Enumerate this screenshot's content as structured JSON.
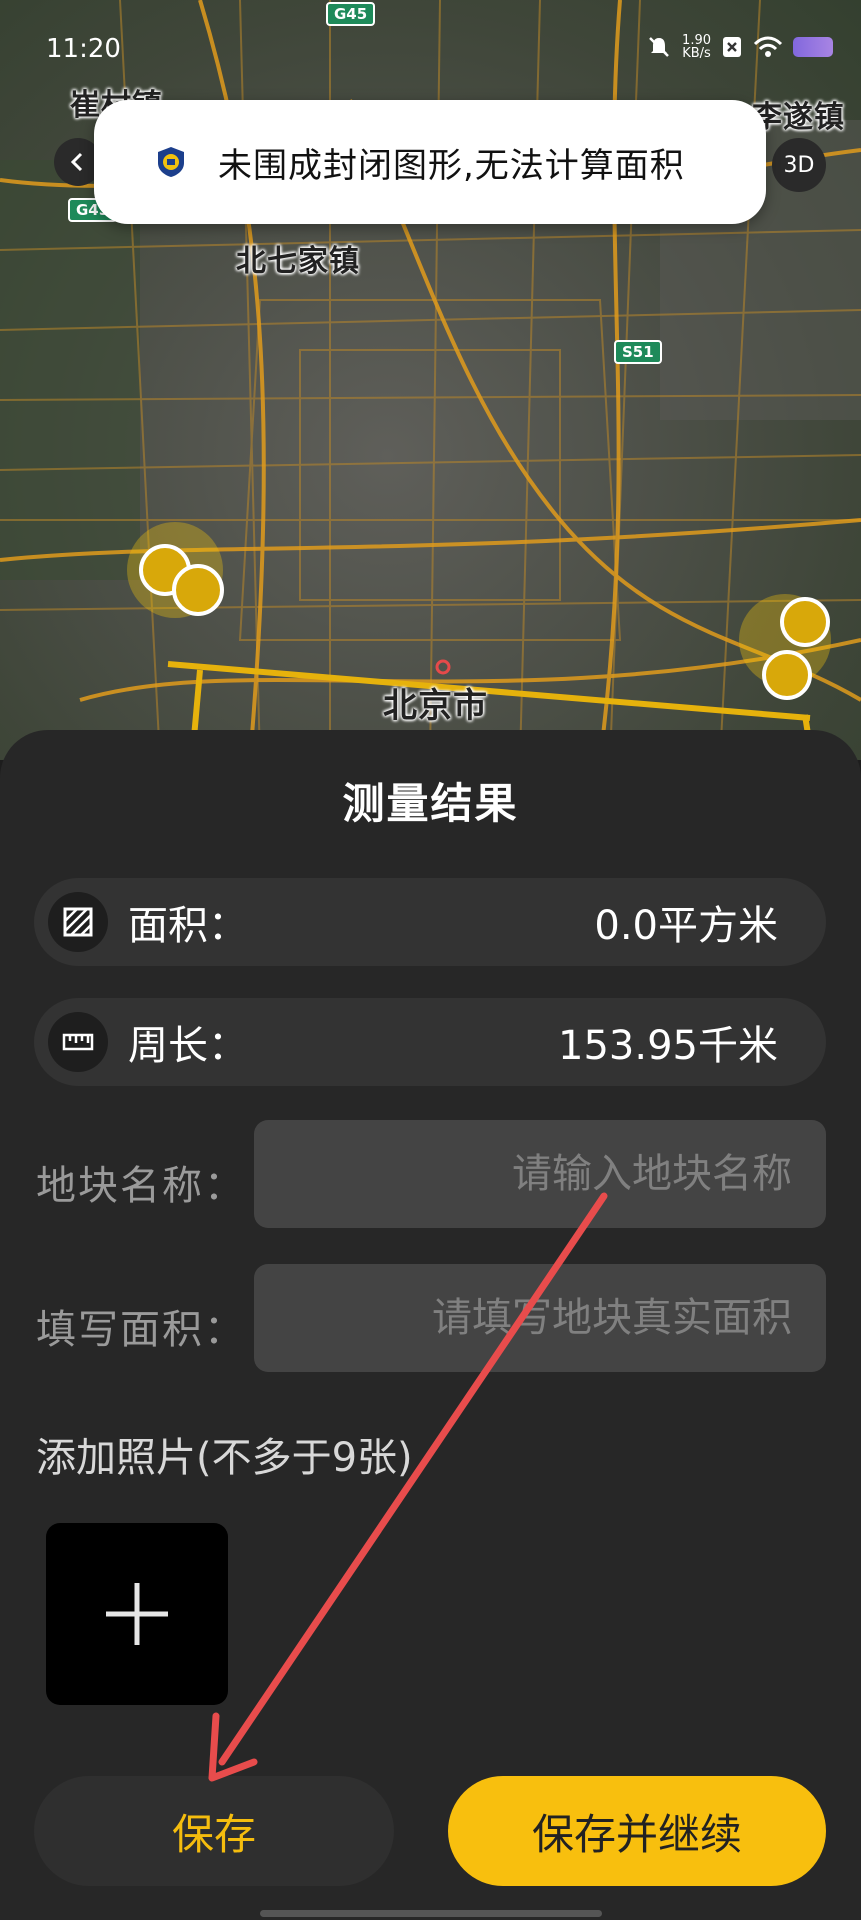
{
  "status_bar": {
    "time": "11:20",
    "net_speed_value": "1.90",
    "net_speed_unit": "KB/s"
  },
  "map": {
    "place_labels": {
      "cuicun": "崔村镇",
      "lisui": "李遂镇",
      "beiqijia": "北七家镇",
      "beijing": "北京市"
    },
    "road_shields": {
      "g45_top": "G45",
      "g45_left": "G45",
      "s51": "S51"
    },
    "three_d_label": "3D"
  },
  "toast": {
    "message": "未围成封闭图形,无法计算面积"
  },
  "sheet": {
    "title": "测量结果",
    "area": {
      "label": "面积：",
      "value": "0.0平方米"
    },
    "perimeter": {
      "label": "周长：",
      "value": "153.95千米"
    },
    "plot_name": {
      "label": "地块名称：",
      "placeholder": "请输入地块名称"
    },
    "fill_area": {
      "label": "填写面积：",
      "placeholder": "请填写地块真实面积"
    },
    "add_photo_label": "添加照片(不多于9张)",
    "save_label": "保存",
    "save_continue_label": "保存并继续"
  },
  "colors": {
    "accent_yellow": "#f8bf0e",
    "sheet_bg": "#272727",
    "annotation_arrow": "#e84c4c"
  }
}
